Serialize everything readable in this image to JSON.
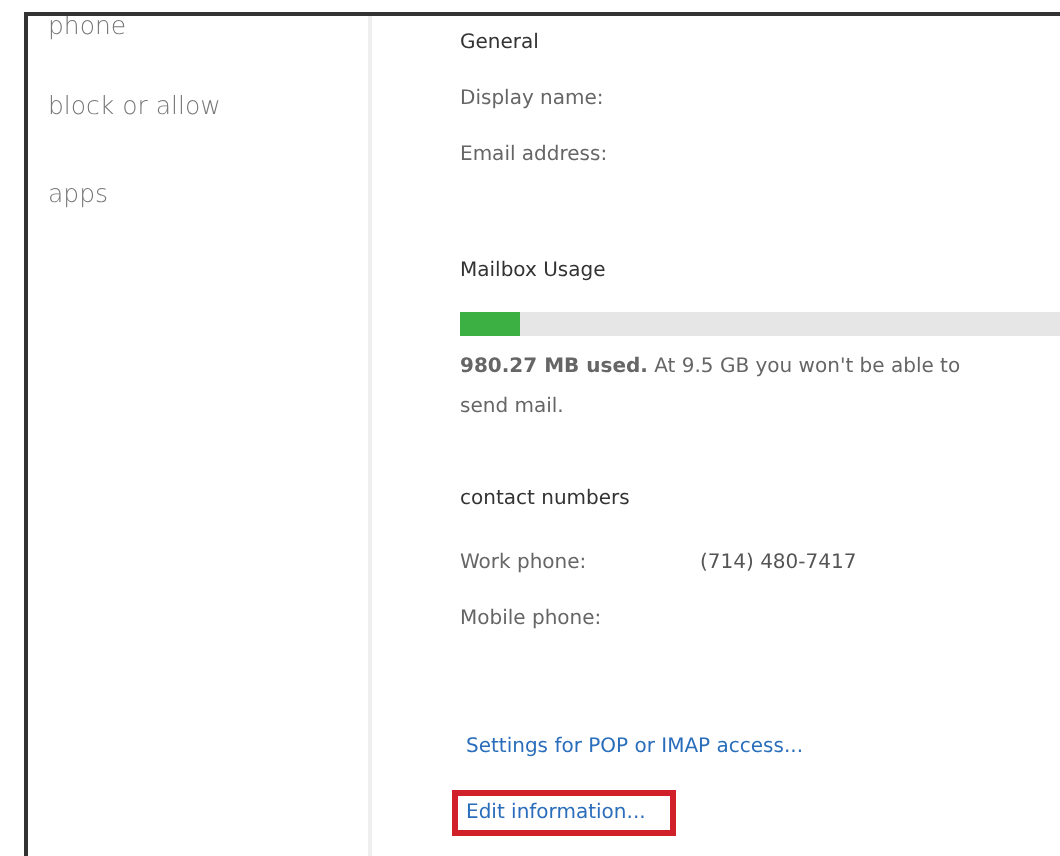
{
  "sidebar": {
    "items": [
      {
        "label": "phone"
      },
      {
        "label": "block or allow"
      },
      {
        "label": "apps"
      }
    ]
  },
  "general": {
    "heading": "General",
    "fields": [
      {
        "label": "Display name:"
      },
      {
        "label": "Email address:"
      }
    ]
  },
  "mailbox_usage": {
    "heading": "Mailbox Usage",
    "level": 0.1,
    "message": "**980.27 MB used.** At 9.5 GB you won't be able to send mail."
  },
  "contact_numbers": {
    "heading": "contact numbers",
    "fields": [
      {
        "label": "Work phone:",
        "value": "(714) 480-7417"
      },
      {
        "label": "Mobile phone:"
      }
    ]
  },
  "links": [
    {
      "label": "Settings for POP or IMAP access...",
      "highlighted": false
    },
    {
      "label": "Edit information...",
      "highlighted": true
    }
  ]
}
